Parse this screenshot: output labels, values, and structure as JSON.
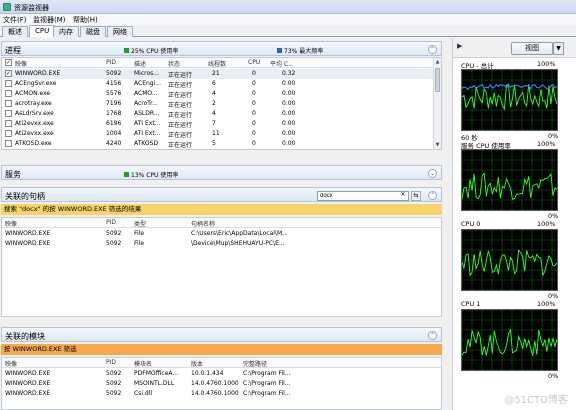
{
  "window": {
    "title": "资源监视器"
  },
  "menu": [
    "文件(F)",
    "监视器(M)",
    "帮助(H)"
  ],
  "tabs": [
    "概述",
    "CPU",
    "内存",
    "磁盘",
    "网络"
  ],
  "active_tab": "CPU",
  "processes": {
    "title": "进程",
    "legend1": "25% CPU 使用率",
    "legend2": "73% 最大频率",
    "columns": [
      "映像",
      "PID",
      "描述",
      "状态",
      "线程数",
      "CPU",
      "平均 C..."
    ],
    "rows": [
      {
        "checked": true,
        "image": "WINWORD.EXE",
        "pid": "5092",
        "desc": "Micros...",
        "status": "正在运行",
        "threads": "21",
        "cpu": "0",
        "avg": "0.32"
      },
      {
        "checked": false,
        "image": "ACEngSvr.exe",
        "pid": "4156",
        "desc": "ACEngi...",
        "status": "正在运行",
        "threads": "6",
        "cpu": "0",
        "avg": "0.00"
      },
      {
        "checked": false,
        "image": "ACMON.exe",
        "pid": "5576",
        "desc": "ACMO...",
        "status": "正在运行",
        "threads": "4",
        "cpu": "0",
        "avg": "0.00"
      },
      {
        "checked": false,
        "image": "acrotray.exe",
        "pid": "7196",
        "desc": "AcroTr...",
        "status": "正在运行",
        "threads": "2",
        "cpu": "0",
        "avg": "0.00"
      },
      {
        "checked": false,
        "image": "AsLdrSrv.exe",
        "pid": "1768",
        "desc": "ASLDR...",
        "status": "正在运行",
        "threads": "4",
        "cpu": "0",
        "avg": "0.00"
      },
      {
        "checked": false,
        "image": "Ati2evxx.exe",
        "pid": "6196",
        "desc": "ATI Ext...",
        "status": "正在运行",
        "threads": "7",
        "cpu": "0",
        "avg": "0.00"
      },
      {
        "checked": false,
        "image": "Ati2evxx.exe",
        "pid": "1004",
        "desc": "ATI Ext...",
        "status": "正在运行",
        "threads": "11",
        "cpu": "0",
        "avg": "0.00"
      },
      {
        "checked": false,
        "image": "ATKOSD.exe",
        "pid": "4240",
        "desc": "ATKOSD",
        "status": "正在运行",
        "threads": "5",
        "cpu": "0",
        "avg": "0.00"
      }
    ]
  },
  "services": {
    "title": "服务",
    "legend": "13% CPU 使用率"
  },
  "handles": {
    "title": "关联的句柄",
    "search_value": "docx",
    "banner": "搜索 \"docx\" 的按 WINWORD.EXE 筛选的结果",
    "columns": [
      "映像",
      "PID",
      "类型",
      "句柄名称"
    ],
    "rows": [
      {
        "image": "WINWORD.EXE",
        "pid": "5092",
        "type": "File",
        "name": "C:\\Users\\Eric\\AppData\\Local\\M..."
      },
      {
        "image": "WINWORD.EXE",
        "pid": "5092",
        "type": "File",
        "name": "\\Device\\Mup\\SHEHUAYU-PC\\E..."
      }
    ]
  },
  "modules": {
    "title": "关联的模块",
    "banner": "按 WINWORD.EXE 筛选",
    "columns": [
      "映像",
      "PID",
      "模块名",
      "版本",
      "完整路径"
    ],
    "rows": [
      {
        "image": "WINWORD.EXE",
        "pid": "5092",
        "module": "PDFMOfficeA...",
        "version": "10.0.1.434",
        "path": "C:\\Program Fil..."
      },
      {
        "image": "WINWORD.EXE",
        "pid": "5092",
        "module": "MSOINTL.DLL",
        "version": "14.0.4760.1000",
        "path": "C:\\Program Fil..."
      },
      {
        "image": "WINWORD.EXE",
        "pid": "5092",
        "module": "Csi.dll",
        "version": "14.0.4760.1000",
        "path": "C:\\Program Fil..."
      }
    ]
  },
  "right_panel": {
    "view_label": "视图",
    "graphs": [
      {
        "label": "CPU - 总计",
        "pct": "100%",
        "footer_left": "60 秒",
        "footer_right": "0%"
      },
      {
        "label": "服务 CPU 使用率",
        "pct": "100%",
        "footer_left": "",
        "footer_right": "0%"
      },
      {
        "label": "CPU 0",
        "pct": "100%",
        "footer_left": "",
        "footer_right": "0%"
      },
      {
        "label": "CPU 1",
        "pct": "100%",
        "footer_left": "",
        "footer_right": "0%"
      }
    ]
  },
  "watermark": "@51CTO博客",
  "colors": {
    "cpu_green": "#18a518",
    "freq_blue": "#2a62c9",
    "graph_bg": "#000000",
    "grid_green": "#0a6a0a",
    "line_green": "#33ff33",
    "line_blue": "#3a78ff",
    "banner_yellow": "#f8d36a",
    "banner_orange": "#f7a84a"
  }
}
